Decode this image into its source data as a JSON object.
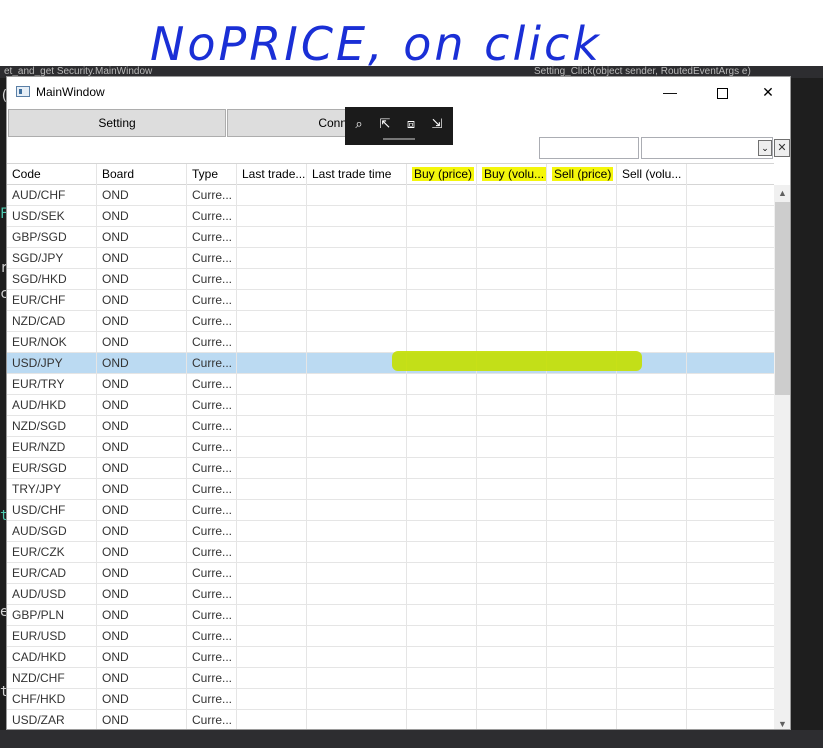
{
  "annotation": {
    "text": "NoPRICE, on click"
  },
  "ide": {
    "left_text": "et_and_get Security.MainWindow",
    "right_text": "Setting_Click(object sender, RoutedEventArgs e)",
    "left_chars": [
      "(",
      "F",
      "r",
      "c",
      "t",
      "e",
      "t"
    ]
  },
  "window": {
    "title": "MainWindow",
    "min": "—",
    "close": "✕"
  },
  "toolbar": {
    "setting_label": "Setting",
    "connect_label": "Conne"
  },
  "debug_toolbar": {
    "icons": [
      "⌕",
      "⇱",
      "⧈",
      "⇲"
    ]
  },
  "filter": {
    "value": "",
    "combo_value": "",
    "clear": "✕",
    "dropdown": "⌄"
  },
  "grid": {
    "columns": [
      "Code",
      "Board",
      "Type",
      "Last trade...",
      "Last trade time",
      "Buy (price)",
      "Buy (volu...",
      "Sell (price)",
      "Sell (volu..."
    ],
    "rows": [
      [
        "AUD/CHF",
        "OND",
        "Curre..."
      ],
      [
        "USD/SEK",
        "OND",
        "Curre..."
      ],
      [
        "GBP/SGD",
        "OND",
        "Curre..."
      ],
      [
        "SGD/JPY",
        "OND",
        "Curre..."
      ],
      [
        "SGD/HKD",
        "OND",
        "Curre..."
      ],
      [
        "EUR/CHF",
        "OND",
        "Curre..."
      ],
      [
        "NZD/CAD",
        "OND",
        "Curre..."
      ],
      [
        "EUR/NOK",
        "OND",
        "Curre..."
      ],
      [
        "USD/JPY",
        "OND",
        "Curre..."
      ],
      [
        "EUR/TRY",
        "OND",
        "Curre..."
      ],
      [
        "AUD/HKD",
        "OND",
        "Curre..."
      ],
      [
        "NZD/SGD",
        "OND",
        "Curre..."
      ],
      [
        "EUR/NZD",
        "OND",
        "Curre..."
      ],
      [
        "EUR/SGD",
        "OND",
        "Curre..."
      ],
      [
        "TRY/JPY",
        "OND",
        "Curre..."
      ],
      [
        "USD/CHF",
        "OND",
        "Curre..."
      ],
      [
        "AUD/SGD",
        "OND",
        "Curre..."
      ],
      [
        "EUR/CZK",
        "OND",
        "Curre..."
      ],
      [
        "EUR/CAD",
        "OND",
        "Curre..."
      ],
      [
        "AUD/USD",
        "OND",
        "Curre..."
      ],
      [
        "GBP/PLN",
        "OND",
        "Curre..."
      ],
      [
        "EUR/USD",
        "OND",
        "Curre..."
      ],
      [
        "CAD/HKD",
        "OND",
        "Curre..."
      ],
      [
        "NZD/CHF",
        "OND",
        "Curre..."
      ],
      [
        "CHF/HKD",
        "OND",
        "Curre..."
      ],
      [
        "USD/ZAR",
        "OND",
        "Curre..."
      ]
    ],
    "selected_index": 8,
    "highlighted_columns": [
      5,
      6,
      7
    ]
  },
  "colors": {
    "highlight_yellow": "#f4f60b",
    "marker_green": "#c4df00",
    "selection": "#bbdaf2",
    "annotation_ink": "#1a2fd6"
  }
}
